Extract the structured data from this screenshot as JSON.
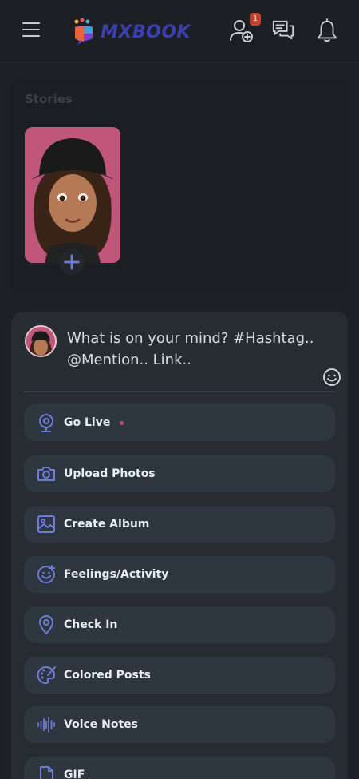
{
  "header": {
    "app_name": "MXBOOK",
    "friend_requests_badge": "1",
    "icons": {
      "menu": "hamburger-icon",
      "friend_requests": "add-user-icon",
      "messages": "chat-icon",
      "notifications": "bell-icon"
    }
  },
  "stories": {
    "title": "Stories",
    "add_icon": "plus-icon"
  },
  "composer": {
    "placeholder": "What is on your mind? #Hashtag.. @Mention.. Link..",
    "emoji_icon": "smiley-icon",
    "actions": [
      {
        "label": "Go Live",
        "icon": "webcam-icon"
      },
      {
        "label": "Upload Photos",
        "icon": "camera-icon"
      },
      {
        "label": "Create Album",
        "icon": "image-icon"
      },
      {
        "label": "Feelings/Activity",
        "icon": "smiley-icon"
      },
      {
        "label": "Check In",
        "icon": "location-pin-icon"
      },
      {
        "label": "Colored Posts",
        "icon": "palette-icon"
      },
      {
        "label": "Voice Notes",
        "icon": "waveform-icon"
      },
      {
        "label": "GIF",
        "icon": "gif-file-icon"
      }
    ]
  },
  "colors": {
    "background": "#1d2125",
    "card": "#262c32",
    "action_button": "#2e3640",
    "icon_accent": "#6e7bd8",
    "brand": "#3b3fb0",
    "badge": "#c2412d",
    "live_dot": "#c04a78"
  }
}
